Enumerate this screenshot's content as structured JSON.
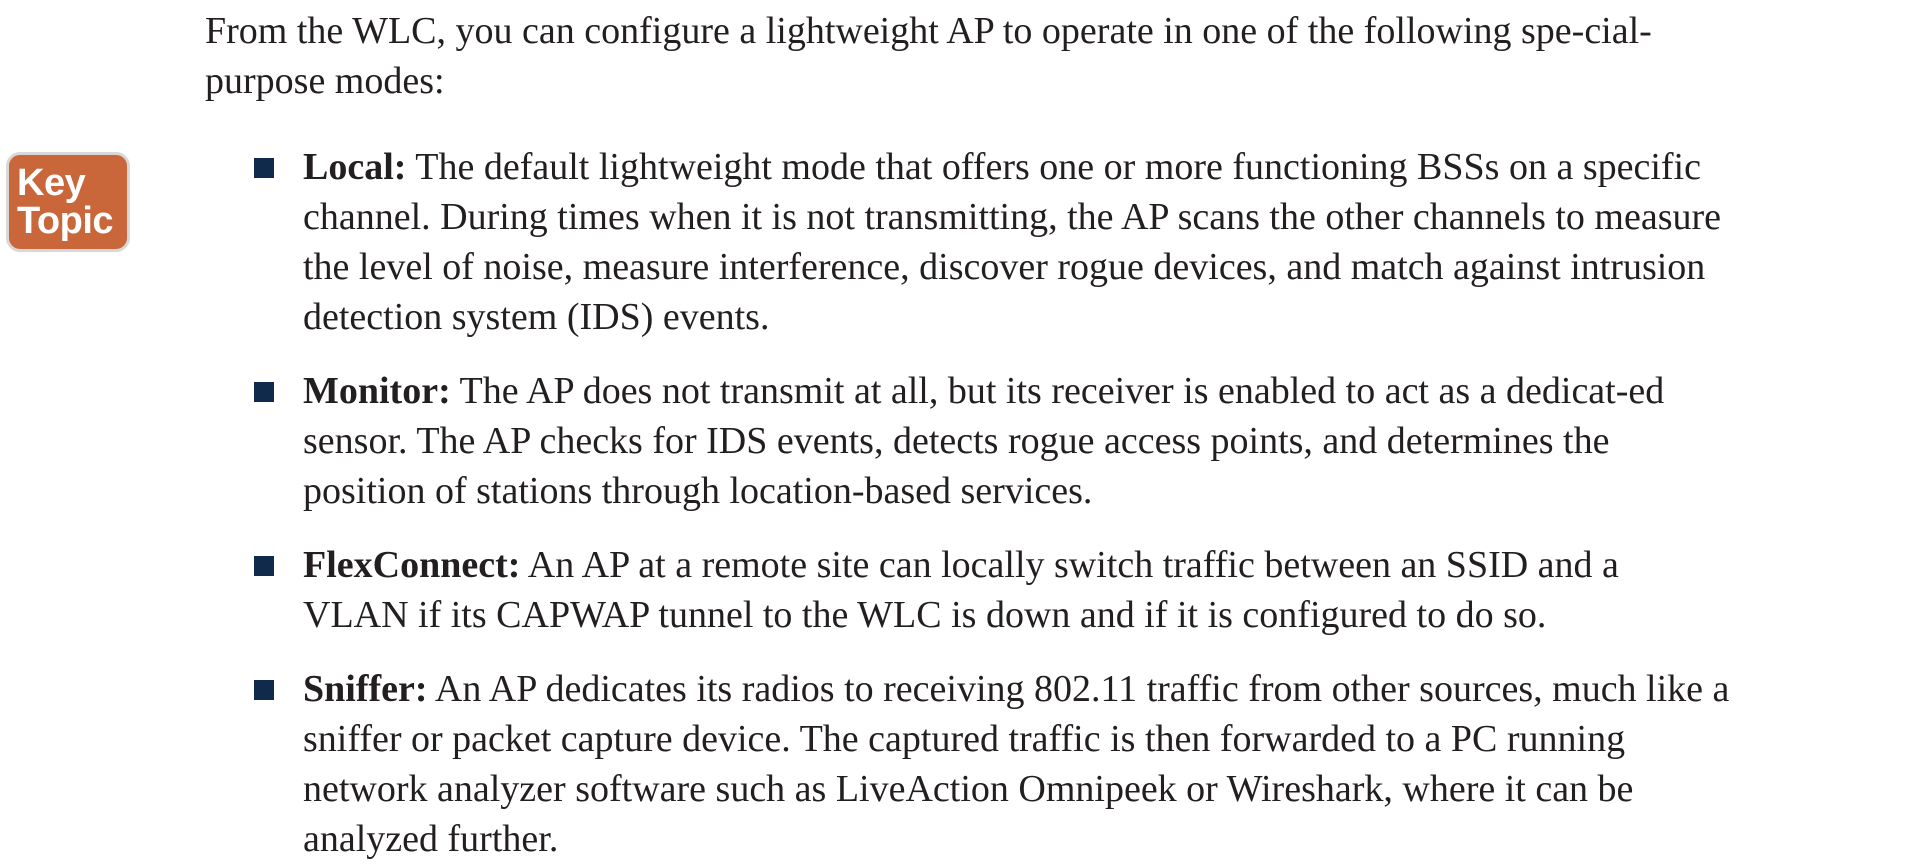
{
  "intro": "From the WLC, you can configure a lightweight AP to operate in one of the following spe-cial-purpose modes:",
  "key_topic": {
    "line1": "Key",
    "line2": "Topic"
  },
  "modes": [
    {
      "term": "Local:",
      "text": " The default lightweight mode that offers one or more functioning BSSs on a specific channel. During times when it is not transmitting, the AP scans the other channels to measure the level of noise, measure interference, discover rogue devices, and match against intrusion detection system (IDS) events."
    },
    {
      "term": "Monitor:",
      "text": " The AP does not transmit at all, but its receiver is enabled to act as a dedicat-ed sensor. The AP checks for IDS events, detects rogue access points, and determines the position of stations through location-based services."
    },
    {
      "term": "FlexConnect:",
      "text": " An AP at a remote site can locally switch traffic between an SSID and a VLAN if its CAPWAP tunnel to the WLC is down and if it is configured to do so."
    },
    {
      "term": "Sniffer:",
      "text": " An AP dedicates its radios to receiving 802.11 traffic from other sources, much like a sniffer or packet capture device. The captured traffic is then forwarded to a PC running network analyzer software such as LiveAction Omnipeek or Wireshark, where it can be analyzed further."
    }
  ],
  "colors": {
    "key_topic_background": "#c9673a",
    "bullet": "#0f2a4a",
    "text": "#231f20"
  }
}
